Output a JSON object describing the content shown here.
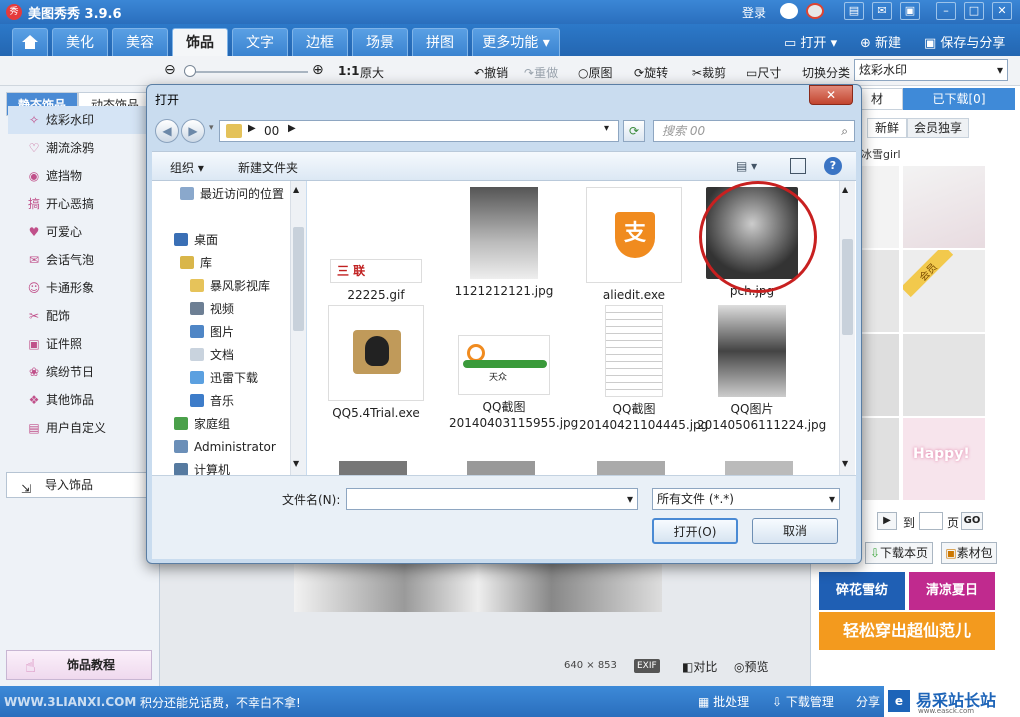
{
  "app": {
    "title": "美图秀秀 3.9.6",
    "logo_text": "秀",
    "login": "登录"
  },
  "tabs": [
    {
      "label": "美化"
    },
    {
      "label": "美容"
    },
    {
      "label": "饰品"
    },
    {
      "label": "文字"
    },
    {
      "label": "边框"
    },
    {
      "label": "场景"
    },
    {
      "label": "拼图"
    },
    {
      "label": "更多功能 ▾"
    }
  ],
  "top_right": {
    "open": "打开",
    "new": "新建",
    "save_share": "保存与分享"
  },
  "workbar": {
    "zoom_ratio": "1:1",
    "original_size": "原大",
    "undo": "撤销",
    "redo": "重做",
    "original": "原图",
    "rotate": "旋转",
    "crop": "裁剪",
    "size": "尺寸",
    "switch_category": "切换分类",
    "category_value": "炫彩水印"
  },
  "left": {
    "tab_static": "静态饰品",
    "tab_dynamic": "动态饰品",
    "items": [
      {
        "label": "炫彩水印",
        "icon": "✧"
      },
      {
        "label": "潮流涂鸦",
        "icon": "♡"
      },
      {
        "label": "遮挡物",
        "icon": "◉"
      },
      {
        "label": "开心恶搞",
        "icon": "搞"
      },
      {
        "label": "可爱心",
        "icon": "♥"
      },
      {
        "label": "会话气泡",
        "icon": "✉"
      },
      {
        "label": "卡通形象",
        "icon": "☺"
      },
      {
        "label": "配饰",
        "icon": "✂"
      },
      {
        "label": "证件照",
        "icon": "▣"
      },
      {
        "label": "缤纷节日",
        "icon": "❀"
      },
      {
        "label": "其他饰品",
        "icon": "❖"
      },
      {
        "label": "用户自定义",
        "icon": "▤"
      }
    ],
    "import": "导入饰品",
    "tutorial": "饰品教程"
  },
  "right": {
    "tab_material": "材",
    "tab_downloaded": "已下载[0]",
    "fresh": "新鲜",
    "member": "会员独享",
    "caption": "冰雪girl",
    "member_badge": "会员",
    "happy": "Happy!",
    "page_to": "到",
    "page_unit": "页",
    "go": "GO",
    "download_page": "下载本页",
    "material_pack": "素材包",
    "banners": [
      {
        "label": "碎花雪纺",
        "color": "#1f5fb4"
      },
      {
        "label": "清凉夏日",
        "color": "#c02a8e"
      },
      {
        "label": "轻松穿出超仙范儿",
        "color": "#f39a1e"
      }
    ]
  },
  "canvas": {
    "dimensions": "640 × 853",
    "exif": "EXIF",
    "compare": "对比",
    "preview": "预览"
  },
  "status": {
    "left_text": "积分还能兑话费，不幸白不拿!",
    "watermark": "WWW.3LIANXI.COM",
    "batch": "批处理",
    "download_mgr": "下载管理",
    "share": "分享",
    "brand": "易采站长站",
    "brand_sub": "www.easck.com"
  },
  "dialog": {
    "title": "打开",
    "path": "00",
    "search_placeholder": "搜索 00",
    "organize": "组织",
    "new_folder": "新建文件夹",
    "nav": [
      {
        "label": "最近访问的位置",
        "color": "#8aa8cc"
      },
      {
        "label": "桌面",
        "color": "#3a6fb5"
      },
      {
        "label": "库",
        "color": "#d9b64a"
      },
      {
        "label": "暴风影视库",
        "color": "#e6c35a"
      },
      {
        "label": "视频",
        "color": "#6d7f94"
      },
      {
        "label": "图片",
        "color": "#4f86c6"
      },
      {
        "label": "文档",
        "color": "#c9d3de"
      },
      {
        "label": "迅雷下载",
        "color": "#5ba0e0"
      },
      {
        "label": "音乐",
        "color": "#3d7cc9"
      },
      {
        "label": "家庭组",
        "color": "#4aa04a"
      },
      {
        "label": "Administrator",
        "color": "#6b8fb8"
      },
      {
        "label": "计算机",
        "color": "#567aa0"
      }
    ],
    "files": [
      {
        "name": "22225.gif"
      },
      {
        "name": "1121212121.jpg"
      },
      {
        "name": "aliedit.exe",
        "glyph": "支"
      },
      {
        "name": "pch.jpg"
      },
      {
        "name": "QQ5.4Trial.exe"
      },
      {
        "name": "QQ截图20140403115955.jpg"
      },
      {
        "name": "QQ截图20140421104445.jpg"
      },
      {
        "name": "QQ图片20140506111224.jpg"
      }
    ],
    "gif_brand": "三 联",
    "qq_brand": "天众",
    "filename_label": "文件名(N):",
    "filename_value": "",
    "filetype_value": "所有文件  (*.*)",
    "open_button": "打开(O)",
    "cancel_button": "取消"
  }
}
